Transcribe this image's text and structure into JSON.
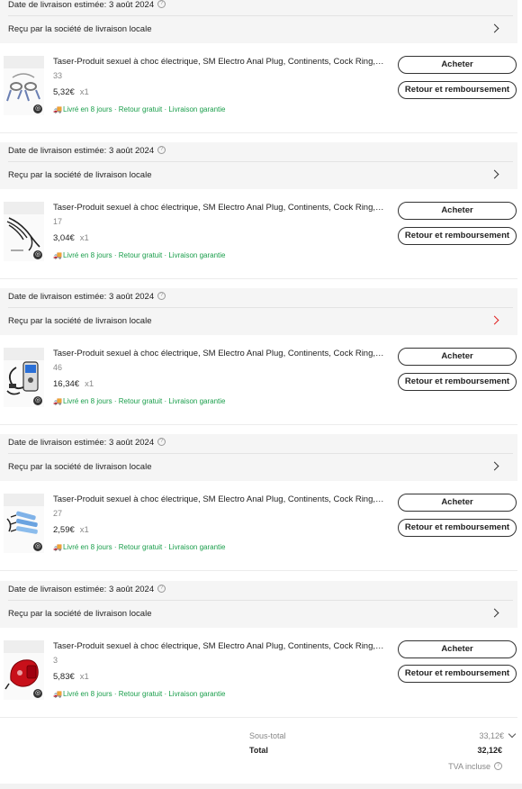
{
  "orders": [
    {
      "delivery_date": "Date de livraison estimée: 3 août 2024",
      "carrier": "Reçu par la société de livraison locale",
      "title": "Taser-Produit sexuel à choc électrique, SM Electro Anal Plug, Continents, Cock Ring, Penis Sleeve",
      "sold": "33",
      "price": "5,32€",
      "qty": "x1",
      "shipping": "Livré en 8 jours · Retour gratuit · Livraison garantie",
      "buy_label": "Acheter",
      "return_label": "Retour et remboursement",
      "thumb_icon": "nipple-clamps-image"
    },
    {
      "delivery_date": "Date de livraison estimée: 3 août 2024",
      "carrier": "Reçu par la société de livraison locale",
      "title": "Taser-Produit sexuel à choc électrique, SM Electro Anal Plug, Continents, Cock Ring, Penis Sleeve",
      "sold": "17",
      "price": "3,04€",
      "qty": "x1",
      "shipping": "Livré en 8 jours · Retour gratuit · Livraison garantie",
      "buy_label": "Acheter",
      "return_label": "Retour et remboursement",
      "thumb_icon": "electrode-wires-image"
    },
    {
      "delivery_date": "Date de livraison estimée: 3 août 2024",
      "carrier": "Reçu par la société de livraison locale",
      "title": "Taser-Produit sexuel à choc électrique, SM Electro Anal Plug, Continents, Cock Ring, Penis Sleeve",
      "sold": "46",
      "price": "16,34€",
      "qty": "x1",
      "shipping": "Livré en 8 jours · Retour gratuit · Livraison garantie",
      "buy_label": "Acheter",
      "return_label": "Retour et remboursement",
      "thumb_icon": "control-unit-image"
    },
    {
      "delivery_date": "Date de livraison estimée: 3 août 2024",
      "carrier": "Reçu par la société de livraison locale",
      "title": "Taser-Produit sexuel à choc électrique, SM Electro Anal Plug, Continents, Cock Ring, Penis Sleeve",
      "sold": "27",
      "price": "2,59€",
      "qty": "x1",
      "shipping": "Livré en 8 jours · Retour gratuit · Livraison garantie",
      "buy_label": "Acheter",
      "return_label": "Retour et remboursement",
      "thumb_icon": "electrode-pads-image"
    },
    {
      "delivery_date": "Date de livraison estimée: 3 août 2024",
      "carrier": "Reçu par la société de livraison locale",
      "title": "Taser-Produit sexuel à choc électrique, SM Electro Anal Plug, Continents, Cock Ring, Penis Sleeve",
      "sold": "3",
      "price": "5,83€",
      "qty": "x1",
      "shipping": "Livré en 8 jours · Retour gratuit · Livraison garantie",
      "buy_label": "Acheter",
      "return_label": "Retour et remboursement",
      "thumb_icon": "red-device-image"
    }
  ],
  "summary": {
    "subtotal_label": "Sous-total",
    "subtotal_value": "33,12€",
    "total_label": "Total",
    "total_value": "32,12€",
    "vat_label": "TVA incluse"
  },
  "colors": {
    "shipping_green": "#1a9e4b",
    "header_bg": "#f5f5f5",
    "highlight_chevron": "#e02020"
  }
}
